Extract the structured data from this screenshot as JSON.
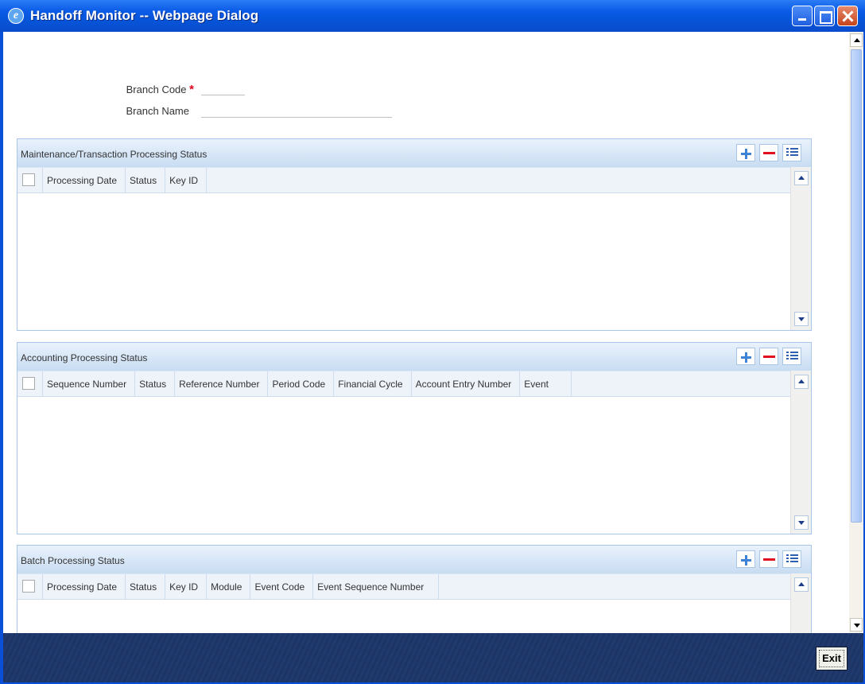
{
  "window": {
    "title": "Handoff Monitor -- Webpage Dialog",
    "icon": "ie-icon"
  },
  "form": {
    "branch_code_label": "Branch Code",
    "required_mark": "*",
    "branch_code_value": "",
    "branch_name_label": "Branch Name",
    "branch_name_value": ""
  },
  "sections": [
    {
      "title": "Maintenance/Transaction Processing Status",
      "columns": [
        "Processing Date",
        "Status",
        "Key ID"
      ]
    },
    {
      "title": "Accounting Processing Status",
      "columns": [
        "Sequence Number",
        "Status",
        "Reference Number",
        "Period Code",
        "Financial Cycle",
        "Account Entry Number",
        "Event"
      ]
    },
    {
      "title": "Batch Processing Status",
      "columns": [
        "Processing Date",
        "Status",
        "Key ID",
        "Module",
        "Event Code",
        "Event Sequence Number"
      ]
    }
  ],
  "footer": {
    "exit_label": "Exit"
  },
  "colors": {
    "titlebar": "#0a5be6",
    "section_header": "#c8dcf2",
    "required": "#e0001a",
    "footer": "#1d3566"
  }
}
